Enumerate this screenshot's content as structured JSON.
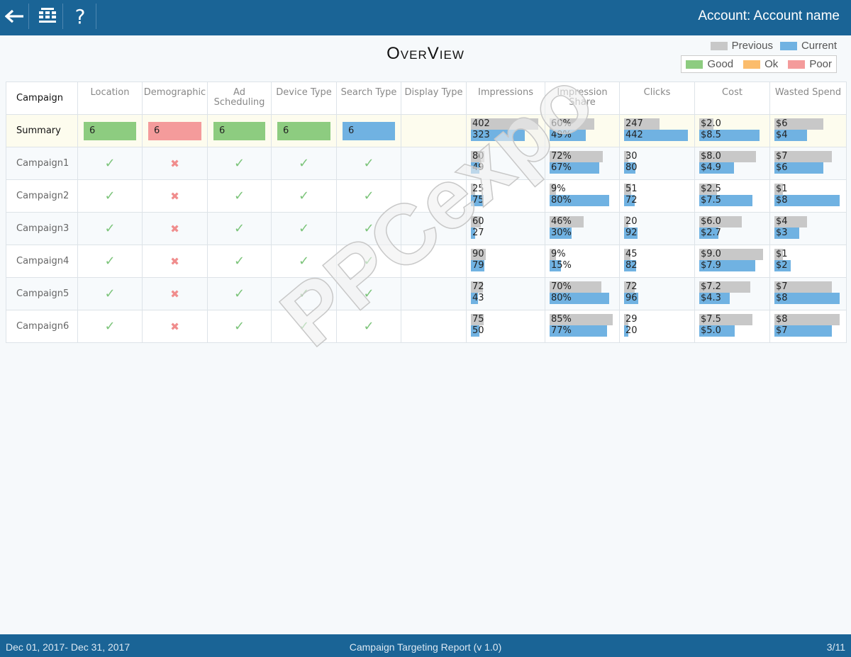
{
  "header": {
    "account": "Account: Account name",
    "back_icon": "arrow-left-icon",
    "grid_icon": "table-grid-icon",
    "help_label": "?"
  },
  "title": "OverView",
  "legend": {
    "previous": "Previous",
    "current": "Current",
    "good": "Good",
    "ok": "Ok",
    "poor": "Poor"
  },
  "colors": {
    "previous": "#c8c8c8",
    "current": "#70b2e2",
    "good": "#8dcc80",
    "ok": "#fbbc6c",
    "poor": "#f49b9b",
    "header": "#1a6496"
  },
  "columns": [
    "Campaign",
    "Location",
    "Demographic",
    "Ad Scheduling",
    "Device Type",
    "Search Type",
    "Display Type",
    "Impressions",
    "Impression Share",
    "Clicks",
    "Cost",
    "Wasted Spend"
  ],
  "summary": {
    "name": "Summary",
    "chips": [
      {
        "value": "6",
        "status": "good"
      },
      {
        "value": "6",
        "status": "poor"
      },
      {
        "value": "6",
        "status": "good"
      },
      {
        "value": "6",
        "status": "good"
      },
      {
        "value": "6",
        "status": "current"
      },
      {
        "value": "",
        "status": "none"
      }
    ],
    "metrics": [
      [
        "402",
        "323",
        402,
        323
      ],
      [
        "60%",
        "49%",
        60,
        49
      ],
      [
        "247",
        "442",
        247,
        442
      ],
      [
        "$2.0",
        "$8.5",
        2.0,
        8.5
      ],
      [
        "$6",
        "$4",
        6,
        4
      ]
    ]
  },
  "rows": [
    {
      "name": "Campaign1",
      "targets": [
        "check",
        "cross",
        "check",
        "check",
        "check",
        ""
      ],
      "metrics": [
        [
          "80",
          "49",
          80,
          49
        ],
        [
          "72%",
          "67%",
          72,
          67
        ],
        [
          "30",
          "80",
          30,
          80
        ],
        [
          "$8.0",
          "$4.9",
          8.0,
          4.9
        ],
        [
          "$7",
          "$6",
          7,
          6
        ]
      ]
    },
    {
      "name": "Campaign2",
      "targets": [
        "check",
        "cross",
        "check",
        "check",
        "check",
        ""
      ],
      "metrics": [
        [
          "25",
          "75",
          25,
          75
        ],
        [
          "9%",
          "80%",
          9,
          80
        ],
        [
          "51",
          "72",
          51,
          72
        ],
        [
          "$2.5",
          "$7.5",
          2.5,
          7.5
        ],
        [
          "$1",
          "$8",
          1,
          8
        ]
      ]
    },
    {
      "name": "Campaign3",
      "targets": [
        "check",
        "cross",
        "check",
        "check",
        "check",
        ""
      ],
      "metrics": [
        [
          "60",
          "27",
          60,
          27
        ],
        [
          "46%",
          "30%",
          46,
          30
        ],
        [
          "20",
          "92",
          20,
          92
        ],
        [
          "$6.0",
          "$2.7",
          6.0,
          2.7
        ],
        [
          "$4",
          "$3",
          4,
          3
        ]
      ]
    },
    {
      "name": "Campaign4",
      "targets": [
        "check",
        "cross",
        "check",
        "check",
        "check",
        ""
      ],
      "metrics": [
        [
          "90",
          "79",
          90,
          79
        ],
        [
          "9%",
          "15%",
          9,
          15
        ],
        [
          "45",
          "82",
          45,
          82
        ],
        [
          "$9.0",
          "$7.9",
          9.0,
          7.9
        ],
        [
          "$1",
          "$2",
          1,
          2
        ]
      ]
    },
    {
      "name": "Campaign5",
      "targets": [
        "check",
        "cross",
        "check",
        "check",
        "check",
        ""
      ],
      "metrics": [
        [
          "72",
          "43",
          72,
          43
        ],
        [
          "70%",
          "80%",
          70,
          80
        ],
        [
          "72",
          "96",
          72,
          96
        ],
        [
          "$7.2",
          "$4.3",
          7.2,
          4.3
        ],
        [
          "$7",
          "$8",
          7,
          8
        ]
      ]
    },
    {
      "name": "Campaign6",
      "targets": [
        "check",
        "cross",
        "check",
        "check",
        "check",
        ""
      ],
      "metrics": [
        [
          "75",
          "50",
          75,
          50
        ],
        [
          "85%",
          "77%",
          85,
          77
        ],
        [
          "29",
          "20",
          29,
          20
        ],
        [
          "$7.5",
          "$5.0",
          7.5,
          5.0
        ],
        [
          "$8",
          "$7",
          8,
          7
        ]
      ]
    }
  ],
  "footer": {
    "date_range": "Dec 01, 2017- Dec 31, 2017",
    "report": "Campaign Targeting Report (v 1.0)",
    "page": "3/11"
  },
  "watermark": "PPCexpo"
}
